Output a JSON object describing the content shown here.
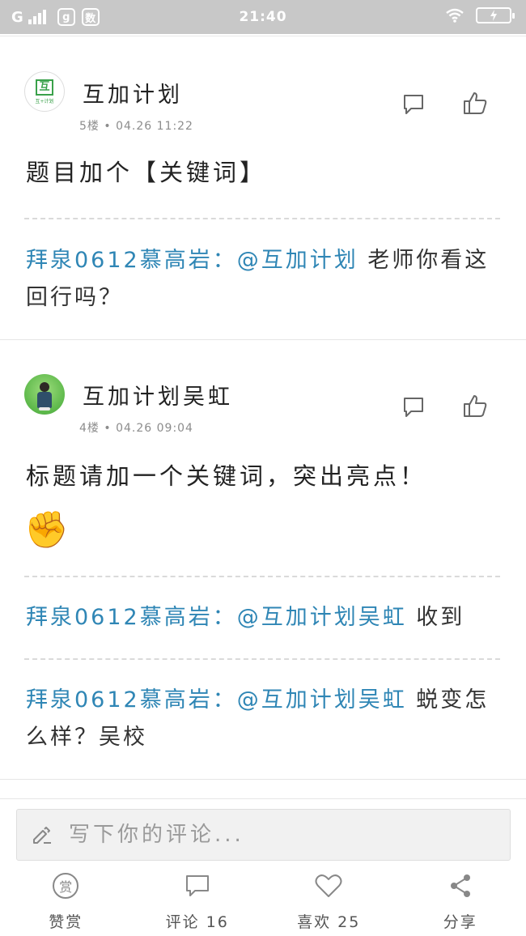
{
  "status_bar": {
    "carrier": "G",
    "time": "21:40",
    "app_icon_1": "g",
    "app_icon_2": "数"
  },
  "comments": [
    {
      "avatar_logo_text": "互",
      "avatar_logo_sub": "互+计划",
      "username": "互加计划",
      "floor": "5楼",
      "timestamp": "04.26 11:22",
      "body": "题目加个【关键词】",
      "replies": [
        {
          "author": "拜泉0612慕高岩：",
          "mention": "@互加计划",
          "text": " 老师你看这回行吗？"
        }
      ]
    },
    {
      "username": "互加计划吴虹",
      "floor": "4楼",
      "timestamp": "04.26 09:04",
      "body": "标题请加一个关键词，突出亮点！",
      "emoji": "✊",
      "replies": [
        {
          "author": "拜泉0612慕高岩：",
          "mention": "@互加计划吴虹",
          "text": " 收到"
        },
        {
          "author": "拜泉0612慕高岩：",
          "mention": "@互加计划吴虹",
          "text": " 蜕变怎么样？吴校"
        }
      ]
    }
  ],
  "compose": {
    "placeholder": "写下你的评论..."
  },
  "toolbar": {
    "reward_icon_text": "赏",
    "reward_label": "赞赏",
    "comment_label": "评论 16",
    "like_label": "喜欢 25",
    "share_label": "分享"
  },
  "colors": {
    "accent_link": "#2f86b5",
    "status_bar": "#c8c8c8",
    "logo_green": "#3aa14a"
  }
}
